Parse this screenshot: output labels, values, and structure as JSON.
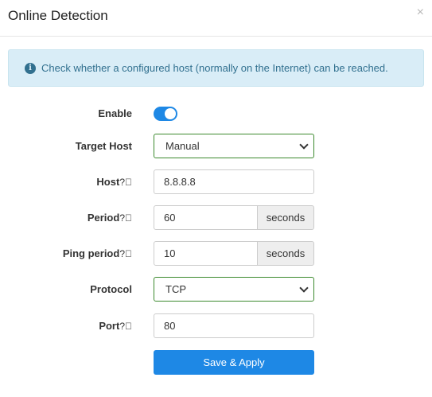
{
  "modal": {
    "title": "Online Detection",
    "close_label": "×"
  },
  "info": {
    "icon": "info-icon",
    "icon_glyph": "i",
    "text": "Check whether a configured host (normally on the Internet) can be reached."
  },
  "form": {
    "enable": {
      "label": "Enable",
      "value": true
    },
    "target_host": {
      "label": "Target Host",
      "value": "Manual"
    },
    "host": {
      "label": "Host",
      "help": "?",
      "value": "8.8.8.8"
    },
    "period": {
      "label": "Period",
      "help": "?",
      "value": "60",
      "unit": "seconds"
    },
    "ping_period": {
      "label": "Ping period",
      "help": "?",
      "value": "10",
      "unit": "seconds"
    },
    "protocol": {
      "label": "Protocol",
      "value": "TCP"
    },
    "port": {
      "label": "Port",
      "help": "?",
      "value": "80"
    }
  },
  "actions": {
    "save_label": "Save & Apply"
  },
  "colors": {
    "accent": "#1e88e5",
    "info_bg": "#d9edf7",
    "info_text": "#31708f",
    "select_border": "#3c8a2e"
  }
}
